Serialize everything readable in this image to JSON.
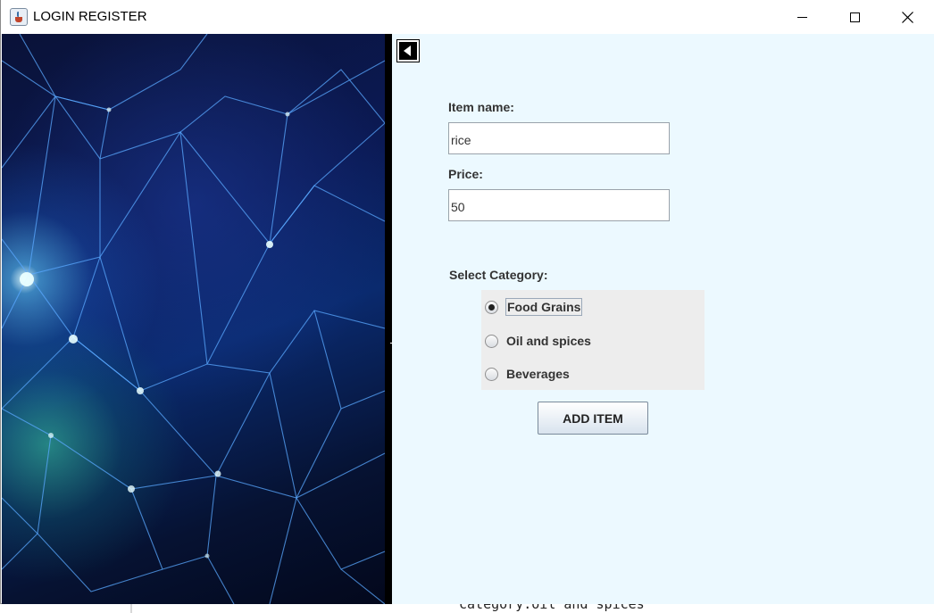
{
  "window": {
    "title": "LOGIN REGISTER",
    "icon": "java-cup-icon",
    "controls": [
      "minimize-icon",
      "maximize-icon",
      "close-icon"
    ]
  },
  "background_text": "category:oil and spices",
  "left_panel": {
    "image": "network-mesh-image"
  },
  "form": {
    "back_icon": "back-arrow-icon",
    "item_name_label": "Item name:",
    "item_name_value": "rice",
    "price_label": "Price:",
    "price_value": "50",
    "category_label": "Select Category:",
    "categories": [
      {
        "label": "Food Grains",
        "checked": true
      },
      {
        "label": "Oil and spices",
        "checked": false
      },
      {
        "label": "Beverages",
        "checked": false
      }
    ],
    "add_button_label": "ADD ITEM"
  },
  "colors": {
    "form_background": "#ecf9ff",
    "radio_group_background": "#ededed",
    "image_panel_dark": "#0b1a55"
  }
}
